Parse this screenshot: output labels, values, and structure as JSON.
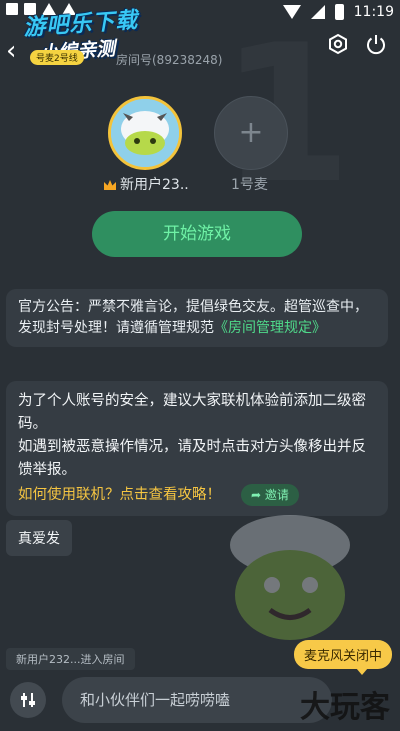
{
  "status_bar": {
    "time": "11:19"
  },
  "watermark": {
    "line1": "游吧乐下载",
    "line2": "小编亲测",
    "brand": "大玩客"
  },
  "header": {
    "room_tag": "号麦2号线",
    "room_number": "房间号(89238248)"
  },
  "seats": [
    {
      "name": "新用户23..",
      "is_host": true
    },
    {
      "name": "1号麦",
      "is_host": false
    }
  ],
  "start_button": "开始游戏",
  "notice": {
    "text": "官方公告：严禁不雅言论，提倡绿色交友。超管巡查中，发现封号处理！请遵循管理规范",
    "link": "《房间管理规定》"
  },
  "tips": {
    "line1": "为了个人账号的安全，建议大家联机体验前添加二级密码。",
    "line2": "如遇到被恶意操作情况，请及时点击对方头像移出并反馈举报。",
    "how_to": "如何使用联机？点击查看攻略！",
    "invite": "邀请"
  },
  "chat_message": "真爱发",
  "system_message": "新用户232...进入房间",
  "mic_status": "麦克风关闭中",
  "input": {
    "placeholder": "和小伙伴们一起唠唠嗑"
  },
  "colors": {
    "accent_green": "#4fd98a",
    "host_ring": "#f3c33b",
    "badge_yellow": "#f7c948"
  }
}
